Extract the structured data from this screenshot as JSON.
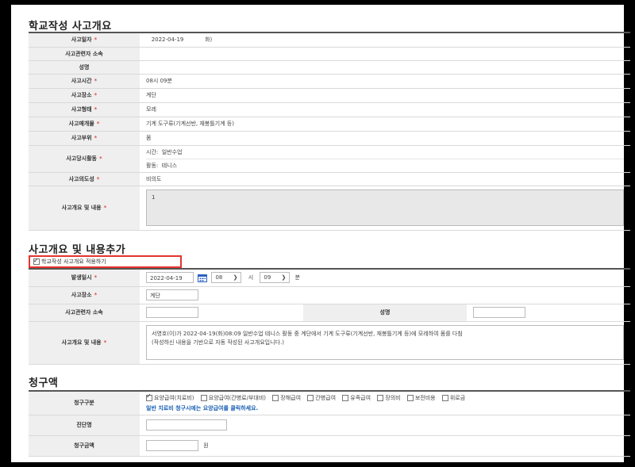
{
  "section1": {
    "title": "학교작성 사고개요",
    "rows": {
      "date": {
        "label": "사고일자",
        "value": "2022-04-19",
        "dow": "화)"
      },
      "affil": {
        "label": "사고관련자 소속",
        "value": ""
      },
      "name": {
        "label": "성명",
        "value": ""
      },
      "time": {
        "label": "사고시간",
        "value": "08시 09분"
      },
      "place": {
        "label": "사고장소",
        "value": "계단"
      },
      "type": {
        "label": "사고형태",
        "value": "모레"
      },
      "medium": {
        "label": "사고매개물",
        "value": "기계 도구류(기계선반, 재봉틀기계 등)"
      },
      "part": {
        "label": "사고부위",
        "value": "몸"
      },
      "activity": {
        "label": "사고당시활동",
        "time_label": "시간:",
        "time_value": "일반수업",
        "act_label": "활동:",
        "act_value": "테니스"
      },
      "intent": {
        "label": "사고의도성",
        "value": "비의도"
      },
      "summary": {
        "label": "사고개요 및 내용",
        "value": "1"
      }
    }
  },
  "section2": {
    "title": "사고개요 및 내용추가",
    "apply_label": "학교작성 사고개요 적용하기",
    "rows": {
      "occurred": {
        "label": "발생일시",
        "date": "2022-04-19",
        "hour": "08",
        "hour_unit": "시",
        "minute": "09",
        "minute_unit": "분"
      },
      "place": {
        "label": "사고장소",
        "value": "계단"
      },
      "affil": {
        "label": "사고관련자 소속",
        "value": ""
      },
      "name": {
        "label": "성명",
        "value": ""
      },
      "summary": {
        "label": "사고개요 및 내용",
        "line1": "서영호(이)가 2022-04-19(화)08:09 일반수업 테니스 활동 중 계단에서 기계 도구류(기계선반, 재봉틀기계 등)에 모레하여 몸를 다침",
        "line2": "(작성하신 내용을 기반으로 자동 작성된 사고개요입니다.)"
      }
    }
  },
  "section3": {
    "title": "청구액",
    "rows": {
      "type": {
        "label": "청구구분",
        "options": [
          "요양급여(치료비)",
          "요양급여(간병료/부대비)",
          "장해급여",
          "간병급여",
          "유족급여",
          "장의비",
          "보전비용",
          "위로금"
        ],
        "note": "일반 치료비 청구시에는 요양급여를 클릭하세요."
      },
      "diag": {
        "label": "진단명",
        "value": ""
      },
      "amount": {
        "label": "청구금액",
        "value": "",
        "unit": "원"
      }
    }
  },
  "colors": {
    "required": "#d9534f",
    "highlight": "#e3342f",
    "note": "#1a5fb4"
  }
}
